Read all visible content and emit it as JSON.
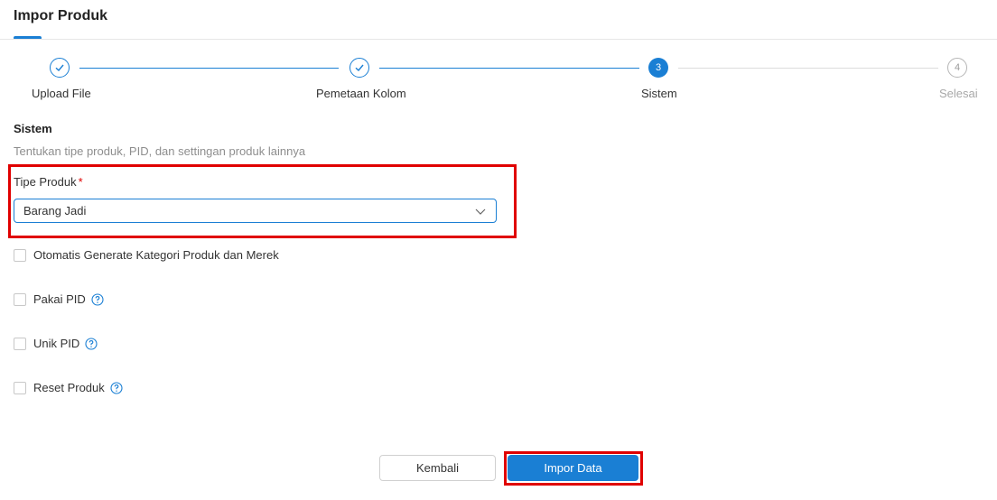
{
  "header": {
    "title": "Impor Produk"
  },
  "stepper": {
    "steps": [
      {
        "label": "Upload File",
        "number": "1",
        "status": "done"
      },
      {
        "label": "Pemetaan Kolom",
        "number": "2",
        "status": "done"
      },
      {
        "label": "Sistem",
        "number": "3",
        "status": "active"
      },
      {
        "label": "Selesai",
        "number": "4",
        "status": "pending"
      }
    ]
  },
  "section": {
    "title": "Sistem",
    "description": "Tentukan tipe produk, PID, dan settingan produk lainnya"
  },
  "product_type": {
    "label": "Tipe Produk",
    "required_mark": "*",
    "selected": "Barang Jadi"
  },
  "options": [
    {
      "label": "Otomatis Generate Kategori Produk dan Merek",
      "checked": false,
      "help": false
    },
    {
      "label": "Pakai PID",
      "checked": false,
      "help": true
    },
    {
      "label": "Unik PID",
      "checked": false,
      "help": true
    },
    {
      "label": "Reset Produk",
      "checked": false,
      "help": true
    }
  ],
  "actions": {
    "back_label": "Kembali",
    "import_label": "Impor Data"
  },
  "colors": {
    "primary": "#1a7fd4",
    "highlight": "#e00000"
  }
}
